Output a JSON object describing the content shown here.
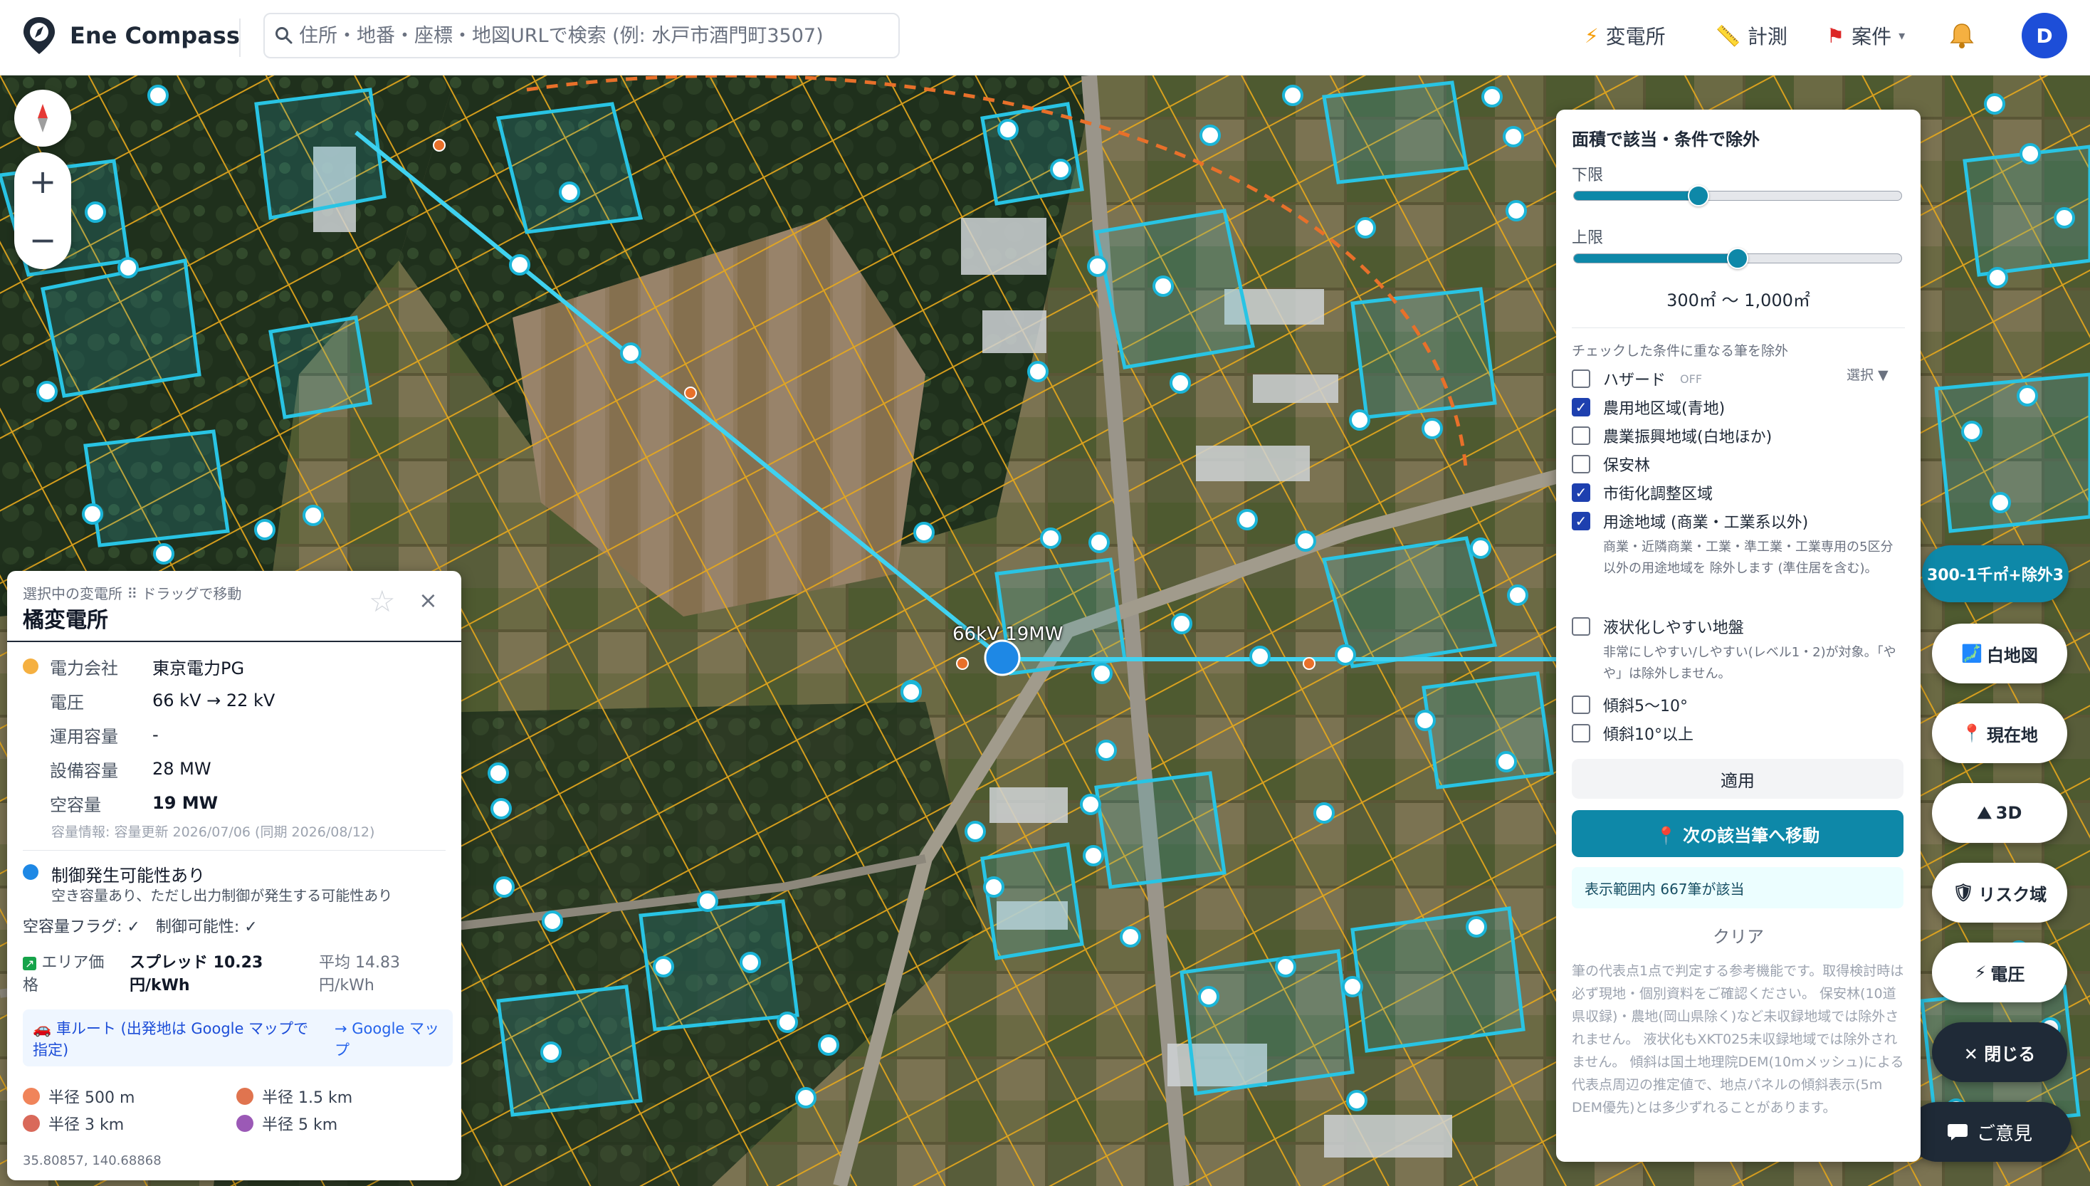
{
  "header": {
    "app_name": "Ene Compass",
    "search_placeholder": "住所・地番・座標・地図URLで検索 (例: 水戸市酒門町3507)",
    "nav": {
      "substation": "変電所",
      "measure": "計測",
      "projects": "案件"
    },
    "user_initial": "D"
  },
  "map": {
    "line_label": "66kV 19MW"
  },
  "substation_panel": {
    "subtitle": "選択中の変電所 ⠿ ドラッグで移動",
    "title": "橘変電所",
    "rows": [
      {
        "label": "電力会社",
        "value": "東京電力PG"
      },
      {
        "label": "電圧",
        "value": "66 kV → 22 kV"
      },
      {
        "label": "運用容量",
        "value": "-"
      },
      {
        "label": "設備容量",
        "value": "28 MW"
      },
      {
        "label": "空容量",
        "value": "19 MW"
      }
    ],
    "capacity_meta": "容量情報: 容量更新 2026/07/06 (同期 2026/08/12)",
    "control_title": "制御発生可能性あり",
    "control_desc": "空き容量あり、ただし出力制御が発生する可能性あり",
    "flags": "空容量フラグ: ✓　制御可能性: ✓",
    "area_label_1": "エリア価",
    "area_label_2": "格",
    "spread_1": "スプレッド 10.23",
    "spread_2": "円/kWh",
    "avg_1": "平均 14.83",
    "avg_2": "円/kWh",
    "route_1": "🚗 車ルート (出発地は Google マップで",
    "route_2": "指定)",
    "route_link_1": "→ Google マッ",
    "route_link_2": "プ",
    "radii": [
      {
        "label": "半径 500 m",
        "color": "#f0845a"
      },
      {
        "label": "半径 1.5 km",
        "color": "#e0744f"
      },
      {
        "label": "半径 3 km",
        "color": "#d9695a"
      },
      {
        "label": "半径 5 km",
        "color": "#9b59b6"
      }
    ],
    "coords": "35.80857, 140.68868",
    "colors": {
      "company_dot": "#f5b041",
      "control_dot": "#1e88e5"
    }
  },
  "filter_panel": {
    "title": "面積で該当・条件で除外",
    "lower_label": "下限",
    "upper_label": "上限",
    "lower_position": 0.38,
    "upper_position": 0.5,
    "range_text": "300㎡ 〜 1,000㎡",
    "exclude_hint": "チェックした条件に重なる筆を除外",
    "select_label": "選択 ▼",
    "hazard_label": "ハザード",
    "hazard_state": "OFF",
    "conditions": [
      {
        "label": "農用地区域(青地)",
        "checked": true
      },
      {
        "label": "農業振興地域(白地ほか)",
        "checked": false
      },
      {
        "label": "保安林",
        "checked": false
      },
      {
        "label": "市街化調整区域",
        "checked": true
      },
      {
        "label": "用途地域 (商業・工業系以外)",
        "checked": true
      }
    ],
    "youto_note": "商業・近隣商業・工業・準工業・工業専用の5区分以外の用途地域を 除外します (準住居を含む)。",
    "liquefaction_label": "液状化しやすい地盤",
    "liquefaction_note": "非常にしやすい/しやすい(レベル1・2)が対象。「やや」は除外しません。",
    "slope1_label": "傾斜5〜10°",
    "slope2_label": "傾斜10°以上",
    "apply_label": "適用",
    "next_label": "📍 次の該当筆へ移動",
    "result_text": "表示範囲内 667筆が該当",
    "clear_label": "クリア",
    "disclaimer": "筆の代表点1点で判定する参考機能です。取得検討時は必ず現地・個別資料をご確認ください。 保安林(10道県収録)・農地(岡山県除く)など未収録地域では除外されません。 液状化もXKT025未収録地域では除外されません。 傾斜は国土地理院DEM(10mメッシュ)による代表点周辺の推定値で、地点パネルの傾斜表示(5m DEM優先)とは多少ずれることがあります。"
  },
  "side_controls": {
    "area_tab": "300-1千㎡+除外3",
    "buttons": [
      {
        "icon": "🗾",
        "label": "白地図"
      },
      {
        "icon": "📍",
        "label": "現在地"
      },
      {
        "icon": "⛰",
        "label": "3D"
      },
      {
        "icon": "🛡",
        "label": "リスク域"
      },
      {
        "icon": "⚡",
        "label": "電圧"
      }
    ],
    "close_label": "✕ 閉じる",
    "feedback_label": "ご意見"
  }
}
